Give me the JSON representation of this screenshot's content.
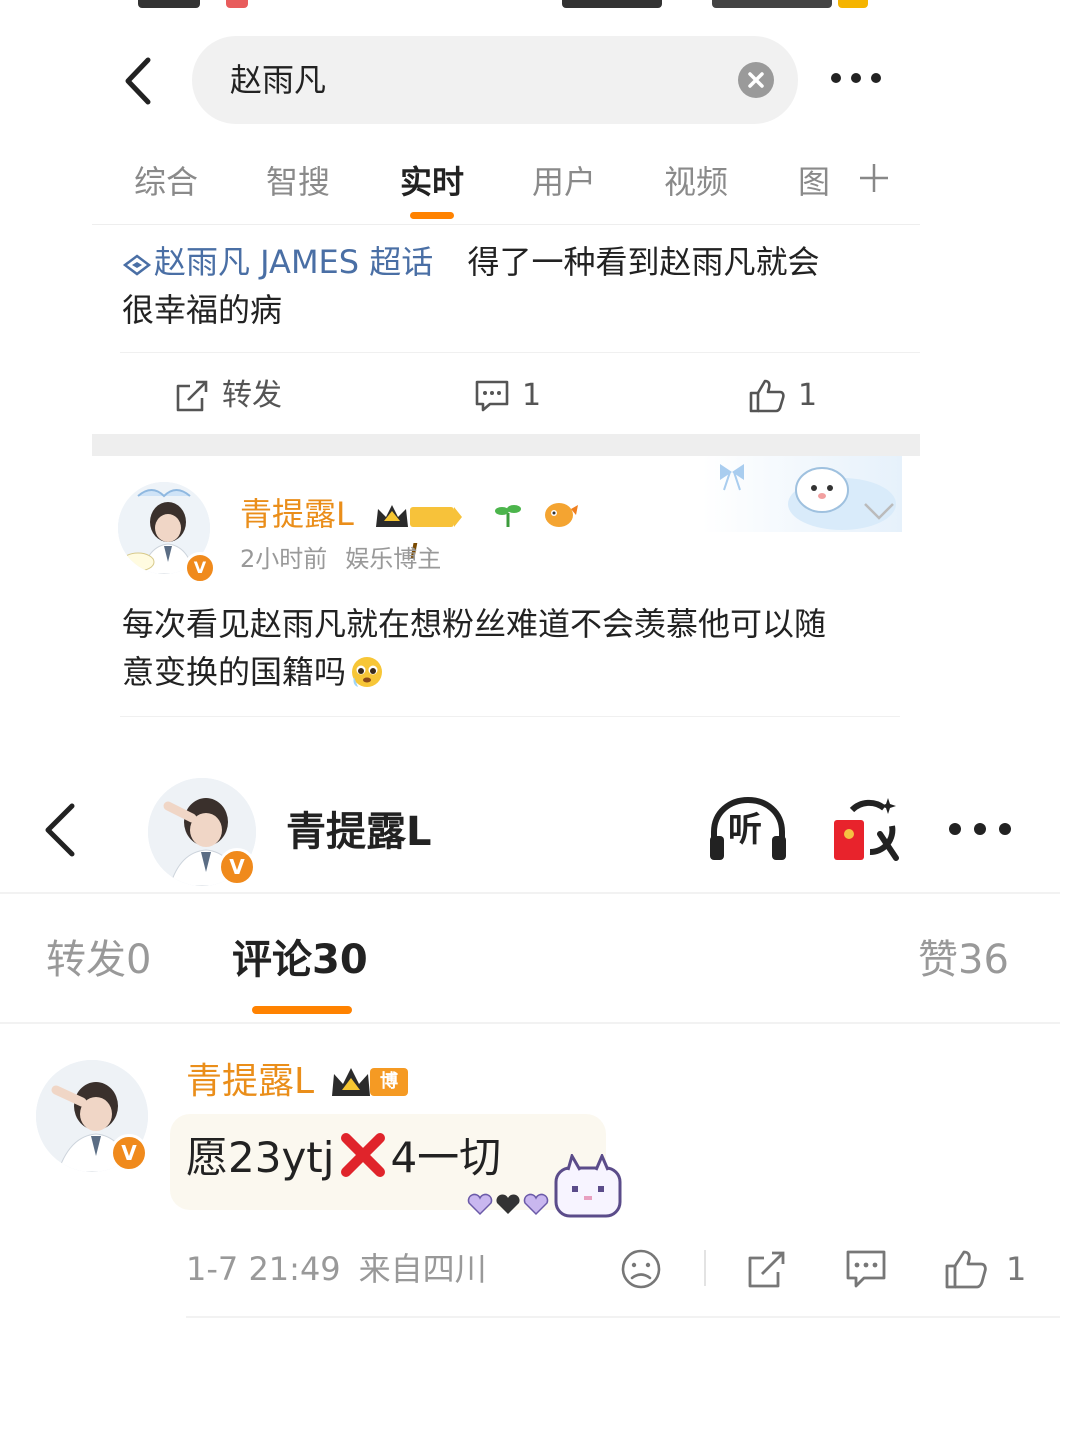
{
  "search": {
    "query": "赵雨凡"
  },
  "tabs": [
    "综合",
    "智搜",
    "实时",
    "用户",
    "视频",
    "图"
  ],
  "post1": {
    "topic": "赵雨凡 JAMES 超话",
    "text_line1": "得了一种看到赵雨凡就会",
    "text_line2": "很幸福的病",
    "repost_label": "转发",
    "comment_count": "1",
    "like_count": "1"
  },
  "post2": {
    "author": "青提露L",
    "level": "I",
    "time": "2小时前",
    "role": "娱乐博主",
    "text_line1": "每次看见赵雨凡就在想粉丝难道不会羡慕他可以随",
    "text_line2": "意变换的国籍吗"
  },
  "detail": {
    "title": "青提露L",
    "listen_label": "听",
    "tabs": {
      "repost": "转发",
      "repost_count": "0",
      "comment": "评论",
      "comment_count": "30",
      "like": "赞",
      "like_count": "36"
    },
    "comment": {
      "author": "青提露L",
      "badge": "博主",
      "text_before": "愿23ytj",
      "text_after": "4一切",
      "date": "1-7 21:49",
      "location": "来自四川",
      "like_count": "1"
    }
  },
  "colors": {
    "accent": "#ff8200",
    "username": "#ea8e1a",
    "link": "#4a6fa5",
    "vbadge": "#f08a1c"
  },
  "icons": [
    "back-icon",
    "clear-icon",
    "more-icon",
    "plus-icon",
    "diamond-icon",
    "share-icon",
    "comment-icon",
    "like-icon",
    "crown-icon",
    "sprout-icon",
    "emoji-icon",
    "chevron-down-icon",
    "listen-icon",
    "red-packet-icon",
    "cross-mark-icon",
    "sad-face-icon"
  ]
}
